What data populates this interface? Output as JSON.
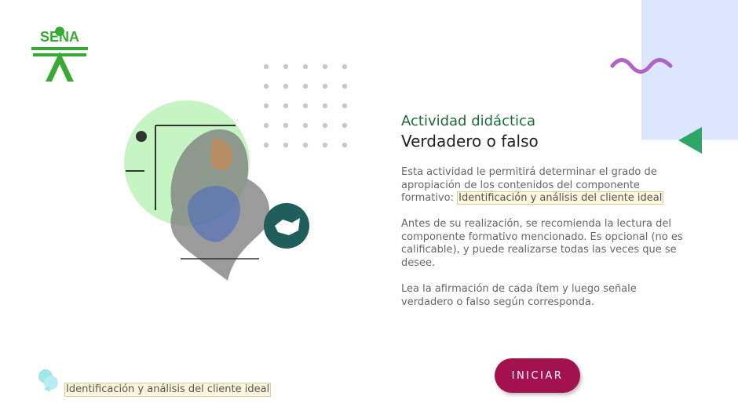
{
  "brand": {
    "logo_text": "SENA"
  },
  "activity": {
    "kicker": "Actividad didáctica",
    "title": "Verdadero o falso"
  },
  "intro": {
    "text": "Esta actividad le permitirá determinar el grado de apropiación de los contenidos del componente formativo:",
    "component_link": "Identificación y análisis del cliente ideal"
  },
  "recommendation": {
    "text": "Antes de su realización, se recomienda la lectura del componente formativo mencionado.  Es opcional (no es calificable), y puede realizarse todas las veces que se desee."
  },
  "instructions": {
    "text": "Lea la afirmación de cada ítem y luego señale verdadero o falso según corresponda."
  },
  "start_button": {
    "label": "INICIAR"
  },
  "footer": {
    "component_label": "Identificación y análisis del cliente ideal"
  },
  "colors": {
    "brand_green": "#39a935",
    "accent_magenta": "#a3124e",
    "panel_lavender": "#dce6ff",
    "wave_purple": "#b163c6",
    "triangle_green": "#2fa568",
    "circle_mint": "#c5f5c2",
    "badge_teal": "#1f5e5b"
  },
  "icons": {
    "wave": "wave-decoration-icon",
    "triangle": "back-triangle-icon",
    "badge": "handshake-badge-icon",
    "footer": "chat-bubble-icon"
  }
}
